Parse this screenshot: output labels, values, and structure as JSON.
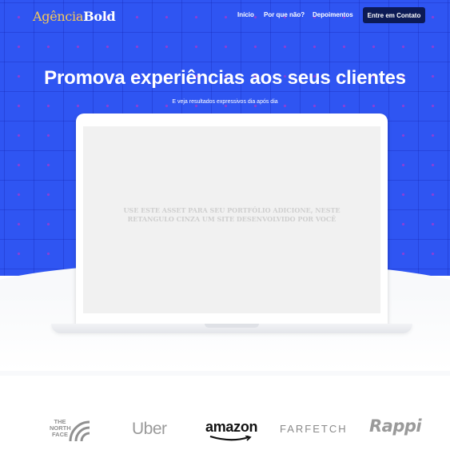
{
  "brand": {
    "logo_part1": "Agência",
    "logo_part2": "Bold"
  },
  "nav": {
    "links": [
      "Início",
      "Por que não?",
      "Depoimentos"
    ],
    "cta": "Entre em Contato"
  },
  "hero": {
    "headline": "Promova experiências aos seus clientes",
    "subheadline": "E veja resultados expressivos dia após dia",
    "placeholder": "USE ESTE ASSET PARA SEU PORTFÓLIO ADICIONE, NESTE RETANGULO CINZA UM SITE DESENVOLVIDO POR VOCÊ"
  },
  "clients": {
    "logos": [
      "THE NORTH FACE",
      "Uber",
      "amazon",
      "FARFETCH",
      "Rappi"
    ],
    "tnf_lines": [
      "THE",
      "NORTH",
      "FACE"
    ]
  },
  "colors": {
    "hero_bg": "#2f55f2",
    "cta_bg": "#0c1a55",
    "logo_accent": "#f4c95a"
  }
}
